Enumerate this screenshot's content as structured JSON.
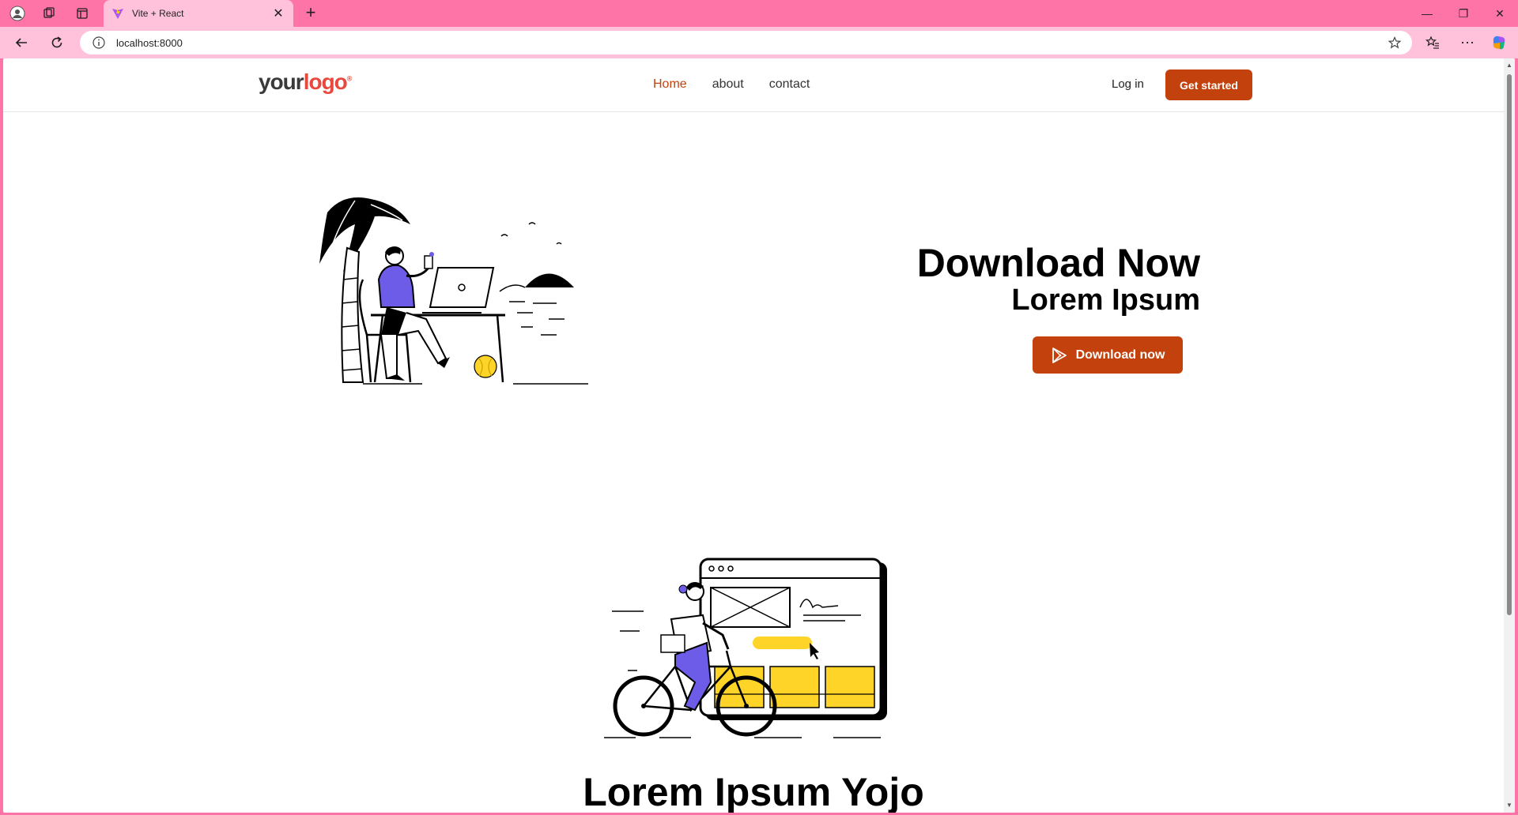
{
  "browser": {
    "tab_title": "Vite + React",
    "url": "localhost:8000"
  },
  "site": {
    "logo_part1": "your",
    "logo_part2": "logo",
    "logo_mark": "®",
    "nav": [
      {
        "label": "Home",
        "active": true
      },
      {
        "label": "about",
        "active": false
      },
      {
        "label": "contact",
        "active": false
      }
    ],
    "login_label": "Log in",
    "cta_label": "Get started"
  },
  "hero": {
    "title": "Download Now",
    "subtitle": "Lorem Ipsum",
    "button_label": "Download now",
    "button_icon": "play-store-icon"
  },
  "section2": {
    "title": "Lorem Ipsum Yojo"
  },
  "colors": {
    "chrome": "#ff74a6",
    "chrome_light": "#ffc2da",
    "accent": "#c2410c",
    "illustration_purple": "#6c5ce7",
    "illustration_yellow": "#ffd428"
  }
}
